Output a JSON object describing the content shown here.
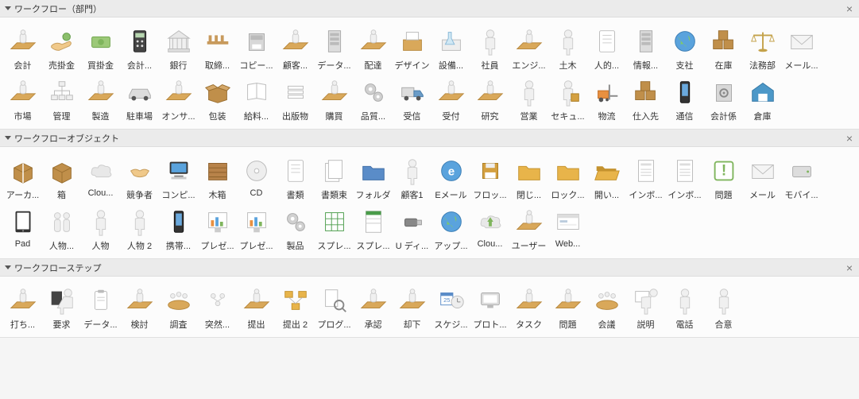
{
  "panels": [
    {
      "title": "ワークフロー（部門）",
      "id": "workflow-dept",
      "items": [
        {
          "label": "会計",
          "icon": "desk"
        },
        {
          "label": "売掛金",
          "icon": "hand-money"
        },
        {
          "label": "買掛金",
          "icon": "cash"
        },
        {
          "label": "会計...",
          "icon": "calculator"
        },
        {
          "label": "銀行",
          "icon": "bank"
        },
        {
          "label": "取締...",
          "icon": "chairs"
        },
        {
          "label": "コピー...",
          "icon": "copier"
        },
        {
          "label": "顧客...",
          "icon": "person-desk"
        },
        {
          "label": "データ...",
          "icon": "server"
        },
        {
          "label": "配達",
          "icon": "desk"
        },
        {
          "label": "デザイン",
          "icon": "design"
        },
        {
          "label": "設備...",
          "icon": "lab"
        },
        {
          "label": "社員",
          "icon": "person"
        },
        {
          "label": "エンジ...",
          "icon": "desk"
        },
        {
          "label": "土木",
          "icon": "person"
        },
        {
          "label": "人的...",
          "icon": "document"
        },
        {
          "label": "情報...",
          "icon": "server"
        },
        {
          "label": "支社",
          "icon": "globe"
        },
        {
          "label": "在庫",
          "icon": "boxes"
        },
        {
          "label": "法務部",
          "icon": "scales"
        },
        {
          "label": "メール...",
          "icon": "mail"
        },
        {
          "label": "市場",
          "icon": "desk"
        },
        {
          "label": "管理",
          "icon": "orgchart"
        },
        {
          "label": "製造",
          "icon": "desk"
        },
        {
          "label": "駐車場",
          "icon": "car"
        },
        {
          "label": "オンサ...",
          "icon": "person-desk"
        },
        {
          "label": "包装",
          "icon": "box-open"
        },
        {
          "label": "給料...",
          "icon": "book"
        },
        {
          "label": "出版物",
          "icon": "paper-stack"
        },
        {
          "label": "購買",
          "icon": "desk"
        },
        {
          "label": "品質...",
          "icon": "gears"
        },
        {
          "label": "受信",
          "icon": "truck"
        },
        {
          "label": "受付",
          "icon": "person-desk"
        },
        {
          "label": "研究",
          "icon": "person-desk"
        },
        {
          "label": "営業",
          "icon": "person"
        },
        {
          "label": "セキュ...",
          "icon": "security"
        },
        {
          "label": "物流",
          "icon": "forklift"
        },
        {
          "label": "仕入先",
          "icon": "boxes"
        },
        {
          "label": "通信",
          "icon": "phone"
        },
        {
          "label": "会計係",
          "icon": "safe"
        },
        {
          "label": "倉庫",
          "icon": "warehouse"
        }
      ]
    },
    {
      "title": "ワークフローオブジェクト",
      "id": "workflow-objects",
      "items": [
        {
          "label": "アーカ...",
          "icon": "box-tied"
        },
        {
          "label": "箱",
          "icon": "box"
        },
        {
          "label": "Clou...",
          "icon": "cloud"
        },
        {
          "label": "競争者",
          "icon": "handshake"
        },
        {
          "label": "コンピ...",
          "icon": "computer"
        },
        {
          "label": "木箱",
          "icon": "crate"
        },
        {
          "label": "CD",
          "icon": "cd"
        },
        {
          "label": "書類",
          "icon": "document"
        },
        {
          "label": "書類束",
          "icon": "doc-stack"
        },
        {
          "label": "フォルダ",
          "icon": "folder-blue"
        },
        {
          "label": "顧客1",
          "icon": "person"
        },
        {
          "label": "Eメール",
          "icon": "email"
        },
        {
          "label": "フロッ...",
          "icon": "floppy"
        },
        {
          "label": "閉じ...",
          "icon": "folder"
        },
        {
          "label": "ロック...",
          "icon": "folder"
        },
        {
          "label": "開い...",
          "icon": "folder-open"
        },
        {
          "label": "インボ...",
          "icon": "form"
        },
        {
          "label": "インボ...",
          "icon": "form"
        },
        {
          "label": "問題",
          "icon": "exclaim"
        },
        {
          "label": "メール",
          "icon": "mail"
        },
        {
          "label": "モバイ...",
          "icon": "hdd"
        },
        {
          "label": "Pad",
          "icon": "pad"
        },
        {
          "label": "人物...",
          "icon": "people"
        },
        {
          "label": "人物",
          "icon": "person"
        },
        {
          "label": "人物 2",
          "icon": "person"
        },
        {
          "label": "携帯...",
          "icon": "phone"
        },
        {
          "label": "プレゼ...",
          "icon": "chart"
        },
        {
          "label": "プレゼ...",
          "icon": "chart"
        },
        {
          "label": "製品",
          "icon": "gears"
        },
        {
          "label": "スプレ...",
          "icon": "sheet"
        },
        {
          "label": "スプレ...",
          "icon": "sheet2"
        },
        {
          "label": "U ディ...",
          "icon": "usb"
        },
        {
          "label": "アップ...",
          "icon": "globe"
        },
        {
          "label": "Clou...",
          "icon": "cloud-up"
        },
        {
          "label": "ユーザー",
          "icon": "user-desk"
        },
        {
          "label": "Web...",
          "icon": "webpage"
        }
      ]
    },
    {
      "title": "ワークフローステップ",
      "id": "workflow-steps",
      "items": [
        {
          "label": "打ち...",
          "icon": "desk"
        },
        {
          "label": "要求",
          "icon": "person-board"
        },
        {
          "label": "データ...",
          "icon": "clipboard"
        },
        {
          "label": "検討",
          "icon": "desk"
        },
        {
          "label": "調査",
          "icon": "meeting"
        },
        {
          "label": "突然...",
          "icon": "group"
        },
        {
          "label": "提出",
          "icon": "desk"
        },
        {
          "label": "提出 2",
          "icon": "network"
        },
        {
          "label": "プログ...",
          "icon": "search-doc"
        },
        {
          "label": "承認",
          "icon": "desk"
        },
        {
          "label": "却下",
          "icon": "desk"
        },
        {
          "label": "スケジ...",
          "icon": "schedule"
        },
        {
          "label": "プロト...",
          "icon": "device"
        },
        {
          "label": "タスク",
          "icon": "desk-star"
        },
        {
          "label": "問題",
          "icon": "desk-excl"
        },
        {
          "label": "会議",
          "icon": "meeting"
        },
        {
          "label": "説明",
          "icon": "present"
        },
        {
          "label": "電話",
          "icon": "person"
        },
        {
          "label": "合意",
          "icon": "person"
        }
      ]
    }
  ]
}
